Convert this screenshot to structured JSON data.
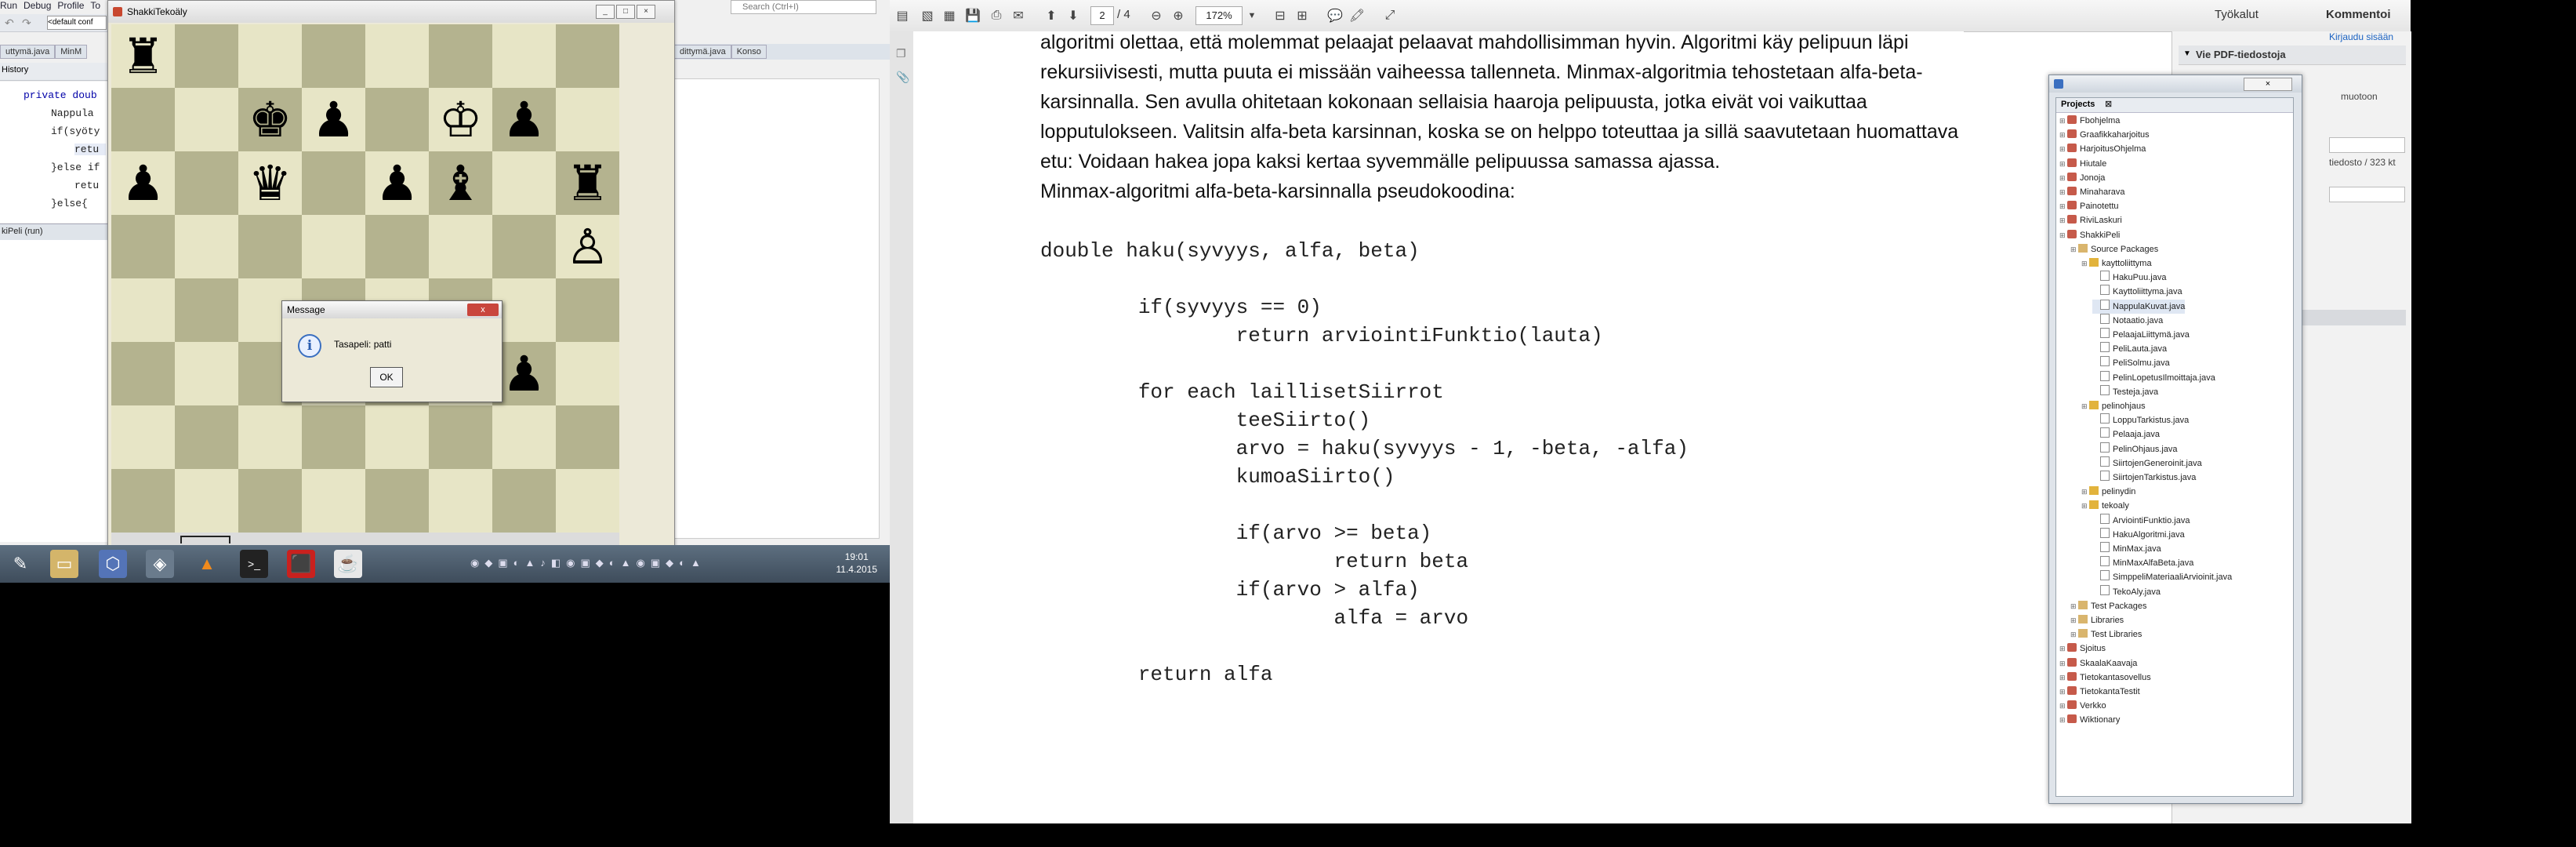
{
  "left_monitor": {
    "netbeans": {
      "menu": [
        "Run",
        "Debug",
        "Profile",
        "To"
      ],
      "config_select": "<default conf",
      "tabs": [
        "uttymä.java",
        "MinM"
      ],
      "editor_tab": "History",
      "code_lines": [
        "private doub",
        "Nappula",
        "if(syöty",
        "retu",
        "}else if",
        "retu",
        "}else{"
      ],
      "output_tab": "kiPeli (run)",
      "right_tabs": [
        "dittymä.java",
        "Konso"
      ],
      "search_placeholder": "Search (Ctrl+I)"
    },
    "chess_window": {
      "title": "ShakkiTekoäly",
      "board": [
        [
          "♜",
          "",
          "",
          "",
          "",
          "",
          "",
          ""
        ],
        [
          "",
          "",
          "♚",
          "♟",
          "",
          "♔",
          "♟",
          ""
        ],
        [
          "♟",
          "",
          "♛",
          "",
          "♟",
          "♝",
          "",
          "♜"
        ],
        [
          "",
          "",
          "",
          "",
          "",
          "",
          "",
          "♙"
        ],
        [
          "",
          "",
          "",
          "",
          "",
          "",
          "",
          ""
        ],
        [
          "",
          "",
          "",
          "",
          "",
          "",
          "♟",
          ""
        ],
        [
          "",
          "",
          "",
          "",
          "",
          "",
          "",
          ""
        ],
        [
          "",
          "",
          "",
          "",
          "",
          "",
          "",
          ""
        ]
      ],
      "dialog": {
        "title": "Message",
        "message": "Tasapeli: patti",
        "ok": "OK",
        "close": "x"
      }
    },
    "taskbar": {
      "icons": [
        "eclipse-icon",
        "folder-icon",
        "virtualbox-icon",
        "app-icon",
        "vlc-icon",
        "terminal-icon",
        "pdf-icon",
        "java-icon"
      ],
      "time": "19:01",
      "date": "11.4.2015"
    }
  },
  "pdf": {
    "page": "2",
    "page_total": "/ 4",
    "zoom": "172%",
    "tools_label": "Työkalut",
    "comment_label": "Kommentoi",
    "signin": "Kirjaudu sisään",
    "export_header": "Vie PDF-tiedostoja",
    "side_text": [
      "muotoon",
      "tiedosto / 323 kt"
    ],
    "paragraph": [
      "algoritmi olettaa, että molemmat pelaajat pelaavat mahdollisimman hyvin. Algoritmi käy pelipuun läpi",
      "rekursiivisesti, mutta puuta ei missään vaiheessa tallenneta. Minmax-algoritmia tehostetaan alfa-beta-",
      "karsinnalla. Sen avulla ohitetaan kokonaan sellaisia haaroja pelipuusta, jotka eivät voi vaikuttaa",
      "lopputulokseen. Valitsin alfa-beta karsinnan, koska se on helppo toteuttaa ja sillä saavutetaan huomattava",
      "etu: Voidaan hakea jopa kaksi kertaa syvemmälle pelipuussa samassa ajassa.",
      " Minmax-algoritmi alfa-beta-karsinnalla pseudokoodina:"
    ],
    "code": [
      "double haku(syvyys, alfa, beta)",
      "",
      "        if(syvyys == 0)",
      "                return arviointiFunktio(lauta)",
      "",
      "        for each laillisetSiirrot",
      "                teeSiirto()",
      "                arvo = haku(syvyys - 1, -beta, -alfa)",
      "                kumoaSiirto()",
      "",
      "                if(arvo >= beta)",
      "                        return beta",
      "                if(arvo > alfa)",
      "                        alfa = arvo",
      "",
      "        return alfa"
    ]
  },
  "projects": {
    "title": "Projects",
    "rows": [
      {
        "text": "Fbohjelma",
        "indent": 0,
        "kind": "proj"
      },
      {
        "text": "Graafikkaharjoitus",
        "indent": 0,
        "kind": "proj"
      },
      {
        "text": "HarjoitusOhjelma",
        "indent": 0,
        "kind": "proj"
      },
      {
        "text": "Hiutale",
        "indent": 0,
        "kind": "proj"
      },
      {
        "text": "Jonoja",
        "indent": 0,
        "kind": "proj"
      },
      {
        "text": "Minaharava",
        "indent": 0,
        "kind": "proj"
      },
      {
        "text": "Painotettu",
        "indent": 0,
        "kind": "proj"
      },
      {
        "text": "RiviLaskuri",
        "indent": 0,
        "kind": "proj"
      },
      {
        "text": "ShakkiPeli",
        "indent": 0,
        "kind": "proj"
      },
      {
        "text": "Source Packages",
        "indent": 1,
        "kind": "folder"
      },
      {
        "text": "kayttoliittyma",
        "indent": 2,
        "kind": "pkg"
      },
      {
        "text": "HakuPuu.java",
        "indent": 3,
        "kind": "java"
      },
      {
        "text": "Kayttoliittyma.java",
        "indent": 3,
        "kind": "java"
      },
      {
        "text": "NappulaKuvat.java",
        "indent": 3,
        "kind": "java"
      },
      {
        "text": "Notaatio.java",
        "indent": 3,
        "kind": "java"
      },
      {
        "text": "PelaajaLiittymä.java",
        "indent": 3,
        "kind": "java"
      },
      {
        "text": "PeliLauta.java",
        "indent": 3,
        "kind": "java"
      },
      {
        "text": "PeliSolmu.java",
        "indent": 3,
        "kind": "java"
      },
      {
        "text": "PelinLopetusIlmoittaja.java",
        "indent": 3,
        "kind": "java"
      },
      {
        "text": "Testeja.java",
        "indent": 3,
        "kind": "java"
      },
      {
        "text": "pelinohjaus",
        "indent": 2,
        "kind": "pkg"
      },
      {
        "text": "LoppuTarkistus.java",
        "indent": 3,
        "kind": "java"
      },
      {
        "text": "Pelaaja.java",
        "indent": 3,
        "kind": "java"
      },
      {
        "text": "PelinOhjaus.java",
        "indent": 3,
        "kind": "java"
      },
      {
        "text": "SiirtojenGeneroinit.java",
        "indent": 3,
        "kind": "java"
      },
      {
        "text": "SiirtojenTarkistus.java",
        "indent": 3,
        "kind": "java"
      },
      {
        "text": "pelinydin",
        "indent": 2,
        "kind": "pkg"
      },
      {
        "text": "tekoaly",
        "indent": 2,
        "kind": "pkg"
      },
      {
        "text": "ArviointiFunktio.java",
        "indent": 3,
        "kind": "java"
      },
      {
        "text": "HakuAlgoritmi.java",
        "indent": 3,
        "kind": "java"
      },
      {
        "text": "MinMax.java",
        "indent": 3,
        "kind": "java"
      },
      {
        "text": "MinMaxAlfaBeta.java",
        "indent": 3,
        "kind": "java"
      },
      {
        "text": "SimppeliMateriaaliArvioinit.java",
        "indent": 3,
        "kind": "java"
      },
      {
        "text": "TekoAly.java",
        "indent": 3,
        "kind": "java"
      },
      {
        "text": "Test Packages",
        "indent": 1,
        "kind": "folder"
      },
      {
        "text": "Libraries",
        "indent": 1,
        "kind": "folder"
      },
      {
        "text": "Test Libraries",
        "indent": 1,
        "kind": "folder"
      },
      {
        "text": "Sjoitus",
        "indent": 0,
        "kind": "proj"
      },
      {
        "text": "SkaalaKaavaja",
        "indent": 0,
        "kind": "proj"
      },
      {
        "text": "Tietokantasovellus",
        "indent": 0,
        "kind": "proj"
      },
      {
        "text": "TietokantaTestit",
        "indent": 0,
        "kind": "proj"
      },
      {
        "text": "Verkko",
        "indent": 0,
        "kind": "proj"
      },
      {
        "text": "Wiktionary",
        "indent": 0,
        "kind": "proj"
      }
    ]
  }
}
